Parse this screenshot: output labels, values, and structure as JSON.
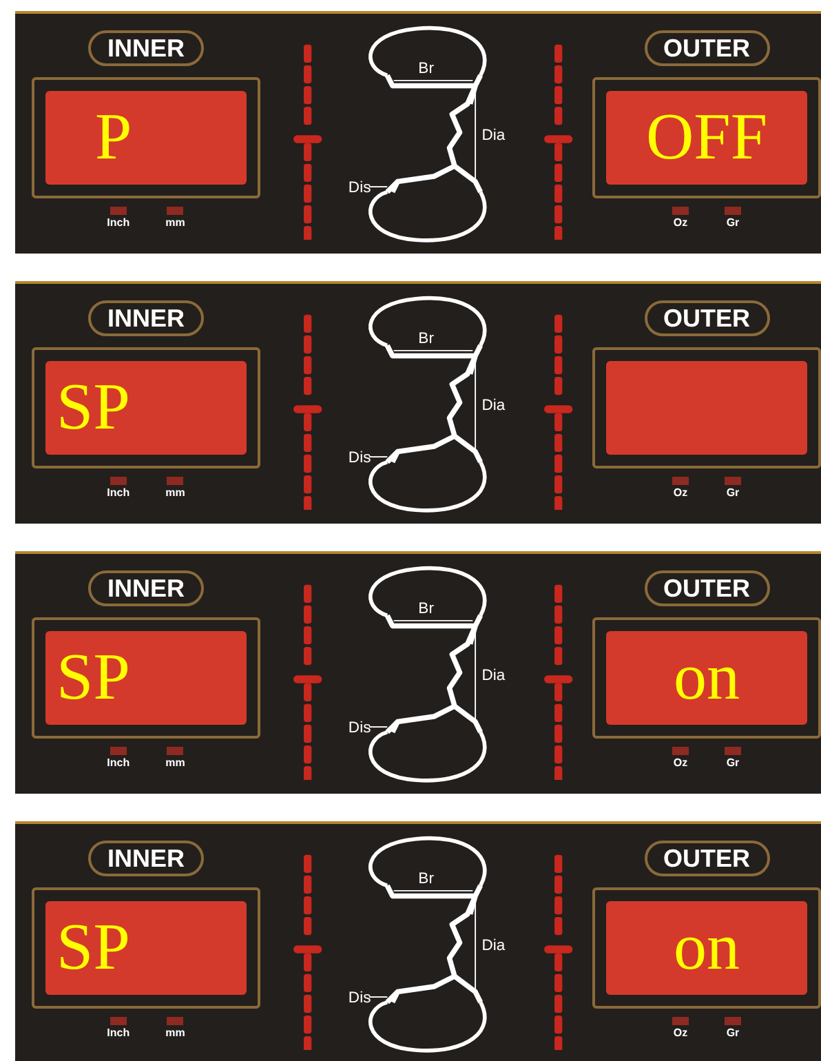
{
  "panels": [
    {
      "inner": {
        "label": "INNER",
        "display": "P",
        "units": [
          "Inch",
          "mm"
        ]
      },
      "wheel": {
        "width_label": "Br",
        "diameter_label": "Dia",
        "distance_label": "Dis"
      },
      "outer": {
        "label": "OUTER",
        "display": "OFF",
        "units": [
          "Oz",
          "Gr"
        ]
      }
    },
    {
      "inner": {
        "label": "INNER",
        "display": "SP",
        "units": [
          "Inch",
          "mm"
        ]
      },
      "wheel": {
        "width_label": "Br",
        "diameter_label": "Dia",
        "distance_label": "Dis"
      },
      "outer": {
        "label": "OUTER",
        "units": [
          "Oz",
          "Gr"
        ]
      }
    },
    {
      "inner": {
        "label": "INNER",
        "display": "SP",
        "units": [
          "Inch",
          "mm"
        ]
      },
      "wheel": {
        "width_label": "Br",
        "diameter_label": "Dia",
        "distance_label": "Dis"
      },
      "outer": {
        "label": "OUTER",
        "display": "on",
        "units": [
          "Oz",
          "Gr"
        ]
      }
    },
    {
      "inner": {
        "label": "INNER",
        "display": "SP",
        "units": [
          "Inch",
          "mm"
        ]
      },
      "wheel": {
        "width_label": "Br",
        "diameter_label": "Dia",
        "distance_label": "Dis"
      },
      "outer": {
        "label": "OUTER",
        "display": "on",
        "units": [
          "Oz",
          "Gr"
        ]
      }
    }
  ]
}
